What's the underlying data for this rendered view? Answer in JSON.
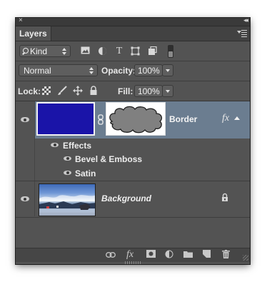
{
  "panel": {
    "tab_label": "Layers",
    "close_glyph": "×",
    "collapse_glyph": "◂◂"
  },
  "filter_bar": {
    "kind_label": "Kind",
    "filter_icons": [
      "image-filter-icon",
      "adjustment-filter-icon",
      "type-filter-icon",
      "shape-filter-icon",
      "smart-object-filter-icon"
    ],
    "type_glyph": "T"
  },
  "blend_bar": {
    "mode_value": "Normal",
    "opacity_label": "Opacity:",
    "opacity_value": "100%"
  },
  "lock_bar": {
    "lock_label": "Lock:",
    "fill_label": "Fill:",
    "fill_value": "100%"
  },
  "layers": [
    {
      "name": "Border",
      "selected": true,
      "fx_label": "fx",
      "thumbnail_color": "#1a14a8",
      "effects_label": "Effects",
      "effects": [
        "Bevel & Emboss",
        "Satin"
      ]
    },
    {
      "name": "Background",
      "selected": false,
      "locked": true
    }
  ],
  "bottom_bar": {
    "fx_label": "fx",
    "icons": [
      "link-layers-icon",
      "add-layer-style-icon",
      "add-mask-icon",
      "new-adjustment-layer-icon",
      "new-group-icon",
      "new-layer-icon",
      "delete-layer-icon"
    ]
  },
  "colors": {
    "panel_bg": "#535353",
    "selected_row": "#6b7d90",
    "layer_fill": "#1a14a8"
  }
}
